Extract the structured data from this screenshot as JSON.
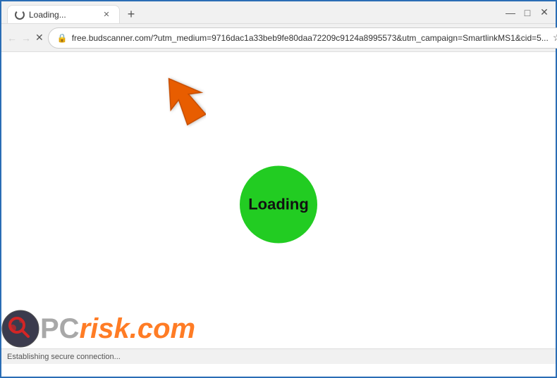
{
  "titlebar": {
    "tab_title": "Loading...",
    "new_tab_label": "+",
    "minimize_label": "—",
    "maximize_label": "□",
    "close_label": "✕"
  },
  "navbar": {
    "back_label": "←",
    "forward_label": "→",
    "close_label": "✕",
    "url": "free.budscanner.com/?utm_medium=9716dac1a33beb9fe80daa72209c9124a8995573&utm_campaign=SmartlinkMS1&cid=5...",
    "star_label": "☆",
    "menu_label": "⋮",
    "lock_label": "🔒"
  },
  "page": {
    "loading_text": "Loading",
    "status_text": "Establishing secure connection..."
  },
  "watermark": {
    "pc_text": "PC",
    "risk_text": "risk.com"
  }
}
